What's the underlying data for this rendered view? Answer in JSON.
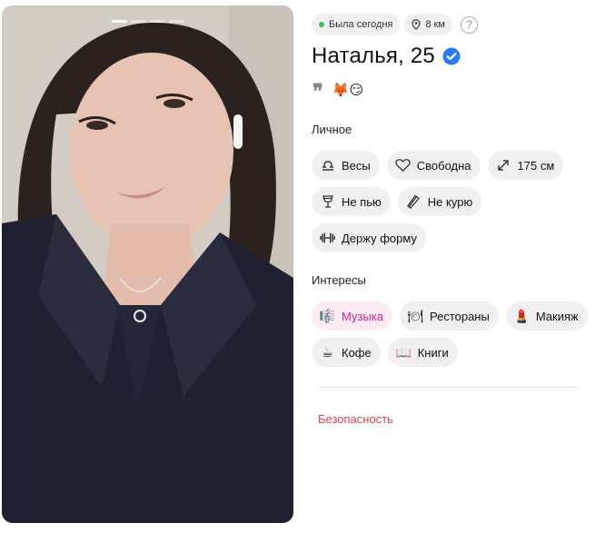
{
  "profile": {
    "status": "Была сегодня",
    "distance": "8 км",
    "help": "?",
    "name": "Наталья, 25",
    "quote_mark": "❞",
    "emoji": "🦊😏"
  },
  "personal": {
    "title": "Личное",
    "items": [
      {
        "label": "Весы",
        "icon": "libra-icon"
      },
      {
        "label": "Свободна",
        "icon": "heart-outline-icon"
      },
      {
        "label": "175 см",
        "icon": "height-arrows-icon"
      },
      {
        "label": "Не пью",
        "icon": "glass-icon"
      },
      {
        "label": "Не курю",
        "icon": "cigarette-off-icon"
      },
      {
        "label": "Держу форму",
        "icon": "dumbbell-icon"
      }
    ]
  },
  "interests": {
    "title": "Интересы",
    "items": [
      {
        "label": "Музыка",
        "icon": "music-icon",
        "glyph": "🎼",
        "highlight": true
      },
      {
        "label": "Рестораны",
        "icon": "plate-icon",
        "glyph": "🍽"
      },
      {
        "label": "Макияж",
        "icon": "lipstick-icon",
        "glyph": "💄"
      },
      {
        "label": "Кофе",
        "icon": "coffee-icon",
        "glyph": "☕"
      },
      {
        "label": "Книги",
        "icon": "book-icon",
        "glyph": "📖"
      }
    ]
  },
  "safety": {
    "label": "Безопасность"
  },
  "photo": {
    "count": 4,
    "active_index": 0
  },
  "colors": {
    "accent": "#2a7cf6",
    "highlight": "#e0208a",
    "danger": "#e2444d",
    "online": "#3cc15a"
  }
}
